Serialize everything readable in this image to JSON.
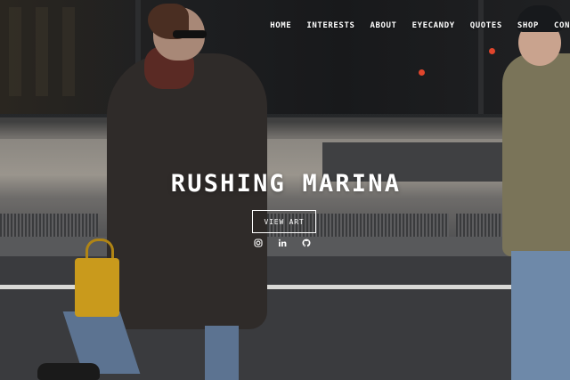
{
  "nav": {
    "items": [
      {
        "label": "HOME"
      },
      {
        "label": "INTERESTS"
      },
      {
        "label": "ABOUT"
      },
      {
        "label": "EYECANDY"
      },
      {
        "label": "QUOTES"
      },
      {
        "label": "SHOP"
      },
      {
        "label": "CON"
      }
    ]
  },
  "hero": {
    "title": "RUSHING MARINA",
    "cta_label": "VIEW ART",
    "background_image": "street-photo-pedestrians"
  },
  "socials": [
    {
      "icon": "instagram-icon"
    },
    {
      "icon": "linkedin-icon"
    },
    {
      "icon": "github-icon"
    }
  ],
  "colors": {
    "text": "#ffffff",
    "bag": "#c99a1c"
  }
}
